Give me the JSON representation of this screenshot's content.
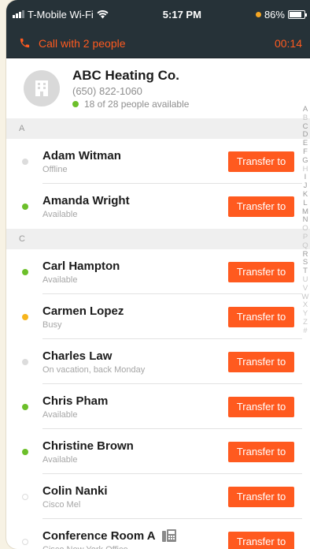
{
  "status_bar": {
    "carrier": "T-Mobile Wi-Fi",
    "time": "5:17 PM",
    "battery": "86%",
    "battery_level": 0.86
  },
  "call": {
    "label": "Call with 2 people",
    "timer": "00:14"
  },
  "company": {
    "name": "ABC Heating Co.",
    "phone": "(650) 822-1060",
    "availability": "18 of 28 people available"
  },
  "sections": [
    {
      "letter": "A",
      "contacts": [
        {
          "name": "Adam Witman",
          "status": "Offline",
          "presence": "offline",
          "button": "Transfer to"
        },
        {
          "name": "Amanda Wright",
          "status": "Available",
          "presence": "available",
          "button": "Transfer to"
        }
      ]
    },
    {
      "letter": "C",
      "contacts": [
        {
          "name": "Carl Hampton",
          "status": "Available",
          "presence": "available",
          "button": "Transfer to"
        },
        {
          "name": "Carmen Lopez",
          "status": "Busy",
          "presence": "busy",
          "button": "Transfer to"
        },
        {
          "name": "Charles Law",
          "status": "On vacation, back Monday",
          "presence": "offline",
          "button": "Transfer to"
        },
        {
          "name": "Chris Pham",
          "status": "Available",
          "presence": "available",
          "button": "Transfer to"
        },
        {
          "name": "Christine Brown",
          "status": "Available",
          "presence": "available",
          "button": "Transfer to"
        },
        {
          "name": "Colin Nanki",
          "status": "Cisco Mel",
          "presence": "none",
          "button": "Transfer to"
        },
        {
          "name": "Conference Room A",
          "status": "Cisco New York Office",
          "presence": "none",
          "button": "Transfer to",
          "icon": "desk-phone-icon"
        }
      ]
    }
  ],
  "alpha_index": [
    "A",
    "B",
    "C",
    "D",
    "E",
    "F",
    "G",
    "H",
    "I",
    "J",
    "K",
    "L",
    "M",
    "N",
    "O",
    "P",
    "Q",
    "R",
    "S",
    "T",
    "U",
    "V",
    "W",
    "X",
    "Y",
    "Z",
    "#"
  ],
  "alpha_index_dim": [
    "B",
    "H",
    "O",
    "P",
    "Q",
    "U",
    "V",
    "W",
    "X",
    "Y",
    "Z",
    "#"
  ],
  "colors": {
    "accent": "#ff5a1f",
    "header_bg": "#263238",
    "available": "#6cbf2a",
    "busy": "#f7b51c",
    "offline": "#dcdcdc"
  }
}
